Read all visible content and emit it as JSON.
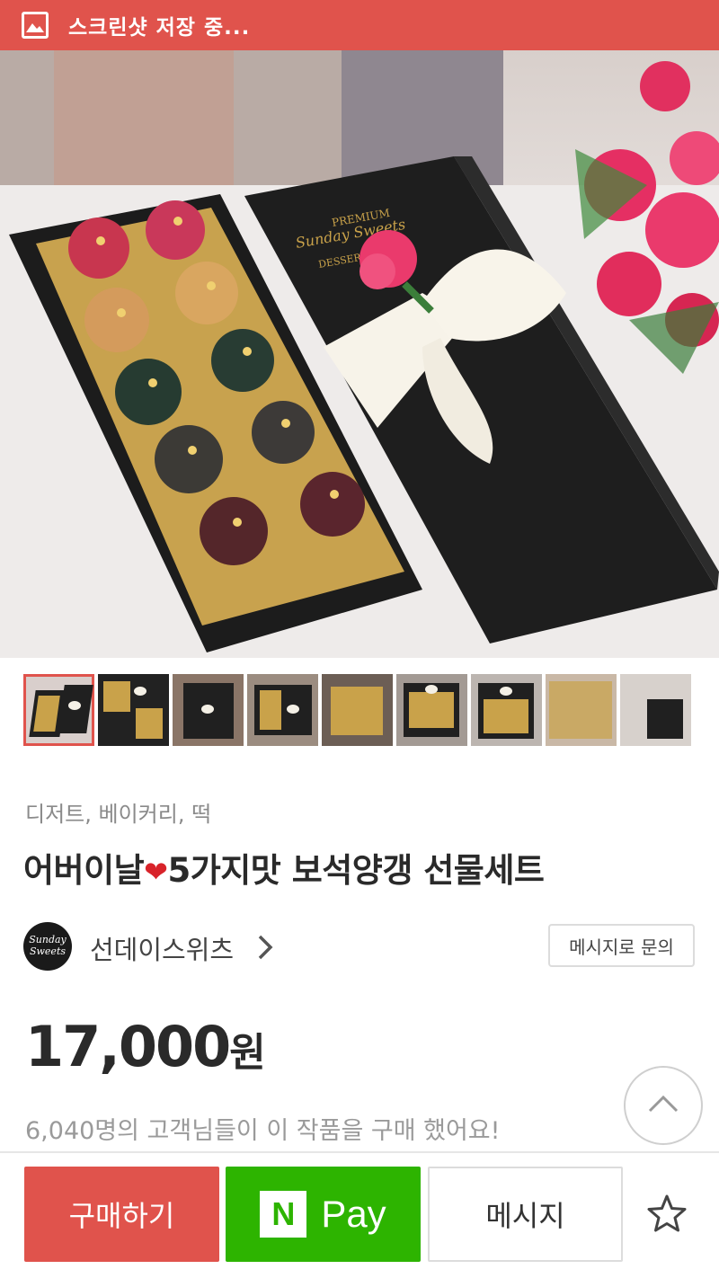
{
  "status_bar": {
    "icon": "screenshot-icon",
    "text": "스크린샷 저장 중..."
  },
  "hero": {
    "image": "product-photo",
    "box_logo_lines": [
      "PREMIUM",
      "Sunday Sweets",
      "DESSERT"
    ]
  },
  "thumbnails": {
    "count": 9,
    "selected_index": 0
  },
  "product": {
    "category": "디저트, 베이커리, 떡",
    "title_before": "어버이날",
    "title_heart": "❤",
    "title_after": "5가지맛 보석양갱 선물세트"
  },
  "shop": {
    "logo_line1": "Sunday",
    "logo_line2": "Sweets",
    "name": "선데이스위츠",
    "inquiry_label": "메시지로 문의"
  },
  "price": {
    "amount": "17,000",
    "unit": "원"
  },
  "buyers_text": "6,040명의 고객님들이 이 작품을 구매 했어요!",
  "actions": {
    "buy_label": "구매하기",
    "npay_logo": "N",
    "npay_label": "Pay",
    "message_label": "메시지"
  },
  "colors": {
    "accent": "#e0534c",
    "npay_green": "#2db400"
  }
}
